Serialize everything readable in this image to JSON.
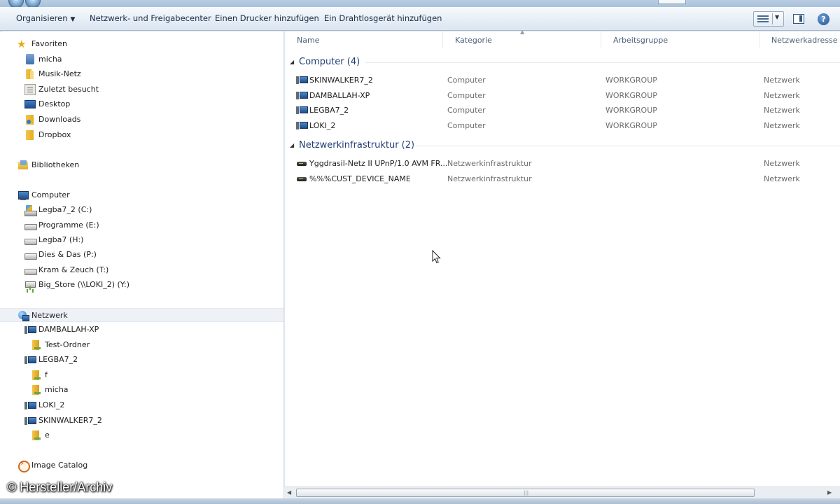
{
  "toolbar": {
    "organize": "Organisieren",
    "network_center": "Netzwerk- und Freigabecenter",
    "add_printer": "Einen Drucker hinzufügen",
    "add_wireless": "Ein Drahtlosgerät hinzufügen"
  },
  "nav": {
    "favorites": {
      "label": "Favoriten",
      "items": [
        "micha",
        "Musik-Netz",
        "Zuletzt besucht",
        "Desktop",
        "Downloads",
        "Dropbox"
      ]
    },
    "libraries": "Bibliotheken",
    "computer": {
      "label": "Computer",
      "items": [
        "Legba7_2 (C:)",
        "Programme (E:)",
        "Legba7 (H:)",
        "Dies & Das (P:)",
        "Kram & Zeuch (T:)",
        "Big_Store (\\\\LOKI_2) (Y:)"
      ]
    },
    "network": {
      "label": "Netzwerk",
      "items": [
        {
          "label": "DAMBALLAH-XP",
          "children": [
            "Test-Ordner"
          ]
        },
        {
          "label": "LEGBA7_2",
          "children": [
            "f",
            "micha"
          ]
        },
        {
          "label": "LOKI_2",
          "children": []
        },
        {
          "label": "SKINWALKER7_2",
          "children": [
            "e"
          ]
        }
      ]
    },
    "image_catalog": "Image Catalog"
  },
  "columns": {
    "name": "Name",
    "category": "Kategorie",
    "workgroup": "Arbeitsgruppe",
    "address": "Netzwerkadresse"
  },
  "groups": [
    {
      "title": "Computer (4)",
      "rows": [
        {
          "name": "SKINWALKER7_2",
          "category": "Computer",
          "workgroup": "WORKGROUP",
          "address": "Netzwerk"
        },
        {
          "name": "DAMBALLAH-XP",
          "category": "Computer",
          "workgroup": "WORKGROUP",
          "address": "Netzwerk"
        },
        {
          "name": "LEGBA7_2",
          "category": "Computer",
          "workgroup": "WORKGROUP",
          "address": "Netzwerk"
        },
        {
          "name": "LOKI_2",
          "category": "Computer",
          "workgroup": "WORKGROUP",
          "address": "Netzwerk"
        }
      ]
    },
    {
      "title": "Netzwerkinfrastruktur (2)",
      "rows": [
        {
          "name": "Yggdrasil-Netz II UPnP/1.0 AVM FR...",
          "category": "Netzwerkinfrastruktur",
          "workgroup": "",
          "address": "Netzwerk"
        },
        {
          "name": "%%%CUST_DEVICE_NAME",
          "category": "Netzwerkinfrastruktur",
          "workgroup": "",
          "address": "Netzwerk"
        }
      ]
    }
  ],
  "watermark": "© Hersteller/Archiv",
  "colors": {
    "accent": "#1f3f73",
    "command_bar": "#e6eef6",
    "muted_text": "#6d6d6d"
  }
}
